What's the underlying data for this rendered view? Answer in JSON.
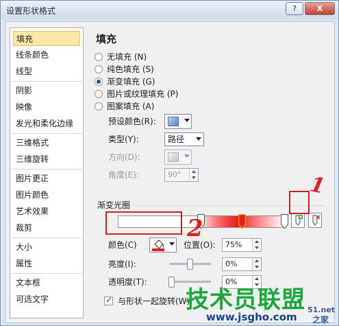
{
  "window": {
    "title": "设置形状格式",
    "help_label": "?",
    "close_label": "X"
  },
  "sidebar": {
    "items": [
      {
        "label": "填充"
      },
      {
        "label": "线条颜色"
      },
      {
        "label": "线型"
      },
      {
        "label": "阴影"
      },
      {
        "label": "映像"
      },
      {
        "label": "发光和柔化边缘"
      },
      {
        "label": "三维格式"
      },
      {
        "label": "三维旋转"
      },
      {
        "label": "图片更正"
      },
      {
        "label": "图片颜色"
      },
      {
        "label": "艺术效果"
      },
      {
        "label": "裁剪"
      },
      {
        "label": "大小"
      },
      {
        "label": "属性"
      },
      {
        "label": "文本框"
      },
      {
        "label": "可选文字"
      }
    ]
  },
  "panel": {
    "title": "填充",
    "fill_options": [
      {
        "label": "无填充 (N)",
        "selected": false
      },
      {
        "label": "纯色填充 (S)",
        "selected": false
      },
      {
        "label": "渐变填充 (G)",
        "selected": true
      },
      {
        "label": "图片或纹理填充 (P)",
        "selected": false
      },
      {
        "label": "图案填充 (A)",
        "selected": false
      }
    ],
    "preset_colors_label": "预设颜色(R):",
    "type_label": "类型(Y):",
    "type_value": "路径",
    "direction_label": "方向(D):",
    "angle_label": "角度(E):",
    "angle_value": "90°",
    "gradient_stops_label": "渐变光圈",
    "color_label": "颜色(C)",
    "color_value": "#e0201d",
    "position_label": "位置(O):",
    "position_value": "75%",
    "brightness_label": "亮度(I):",
    "brightness_value": "0%",
    "transparency_label": "透明度(T):",
    "transparency_value": "0%",
    "rotate_with_shape_label": "与形状一起旋转(W)",
    "rotate_with_shape_checked": true
  },
  "annotations": {
    "mark_1": "1",
    "mark_2": "2"
  },
  "watermark": {
    "brand": "技术员联盟",
    "site": "www.jsgho.com",
    "corner": "51.net",
    "corner2": "之家"
  }
}
